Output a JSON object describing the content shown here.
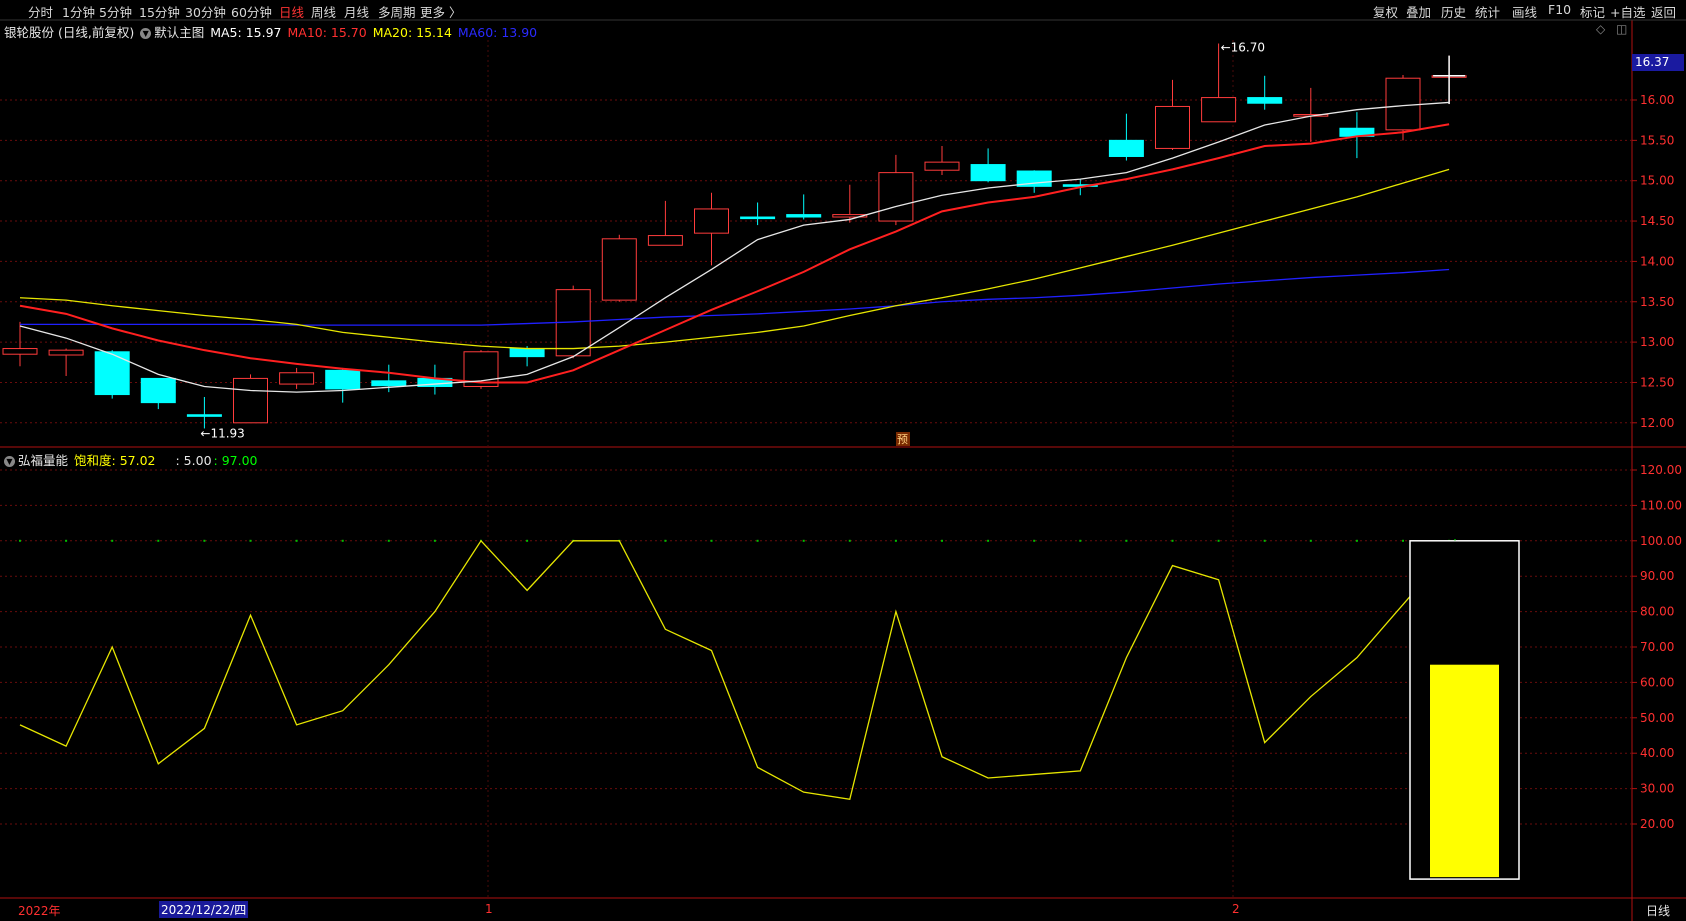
{
  "topbar": {
    "left_tabs": [
      "分时",
      "1分钟",
      "5分钟",
      "15分钟",
      "30分钟",
      "60分钟",
      "日线",
      "周线",
      "月线",
      "多周期",
      "更多 〉"
    ],
    "active": "日线",
    "right_tabs": [
      "复权",
      "叠加",
      "历史",
      "统计",
      "画线",
      "F10",
      "标记",
      "+自选",
      "返回"
    ]
  },
  "main_legend": {
    "stock": "银轮股份 (日线,前复权)",
    "chart_name": "默认主图",
    "ma5": "MA5: 15.97",
    "ma10": "MA10: 15.70",
    "ma20": "MA20: 15.14",
    "ma60": "MA60: 13.90"
  },
  "sub_legend": {
    "name": "弘福量能",
    "saturation": "饱和度: 57.02",
    "val1": ": 5.00",
    "val2": ": 97.00"
  },
  "annotations": {
    "high": "16.70",
    "low": "11.93",
    "pre_badge": "预"
  },
  "price_box": "16.37",
  "bottom": {
    "year": "2022年",
    "cursor_date": "2022/12/22/四",
    "month1": "1",
    "month2": "2",
    "period": "日线"
  },
  "chart_data": [
    {
      "type": "candlestick",
      "yticks": [
        "16.00",
        "15.50",
        "15.00",
        "14.50",
        "14.00",
        "13.50",
        "13.00",
        "12.50",
        "12.00"
      ],
      "ylim": [
        11.8,
        16.5
      ],
      "candles": [
        {
          "o": 12.85,
          "c": 12.92,
          "h": 13.25,
          "l": 12.7
        },
        {
          "o": 12.84,
          "c": 12.9,
          "h": 12.92,
          "l": 12.58
        },
        {
          "o": 12.88,
          "c": 12.35,
          "h": 12.9,
          "l": 12.3
        },
        {
          "o": 12.55,
          "c": 12.25,
          "h": 12.55,
          "l": 12.17
        },
        {
          "o": 12.1,
          "c": 12.08,
          "h": 12.32,
          "l": 11.93
        },
        {
          "o": 12.0,
          "c": 12.55,
          "h": 12.6,
          "l": 12.0
        },
        {
          "o": 12.48,
          "c": 12.62,
          "h": 12.68,
          "l": 12.42
        },
        {
          "o": 12.65,
          "c": 12.42,
          "h": 12.68,
          "l": 12.25
        },
        {
          "o": 12.52,
          "c": 12.46,
          "h": 12.72,
          "l": 12.38
        },
        {
          "o": 12.55,
          "c": 12.45,
          "h": 12.72,
          "l": 12.35
        },
        {
          "o": 12.45,
          "c": 12.88,
          "h": 12.9,
          "l": 12.42
        },
        {
          "o": 12.92,
          "c": 12.82,
          "h": 12.95,
          "l": 12.7
        },
        {
          "o": 12.83,
          "c": 13.65,
          "h": 13.7,
          "l": 12.8
        },
        {
          "o": 13.52,
          "c": 14.28,
          "h": 14.33,
          "l": 13.5
        },
        {
          "o": 14.2,
          "c": 14.32,
          "h": 14.75,
          "l": 14.2
        },
        {
          "o": 14.35,
          "c": 14.65,
          "h": 14.85,
          "l": 13.95
        },
        {
          "o": 14.55,
          "c": 14.53,
          "h": 14.73,
          "l": 14.45
        },
        {
          "o": 14.58,
          "c": 14.55,
          "h": 14.83,
          "l": 14.52
        },
        {
          "o": 14.55,
          "c": 14.58,
          "h": 14.95,
          "l": 14.48
        },
        {
          "o": 14.5,
          "c": 15.1,
          "h": 15.32,
          "l": 14.45
        },
        {
          "o": 15.13,
          "c": 15.23,
          "h": 15.43,
          "l": 15.07
        },
        {
          "o": 15.2,
          "c": 15.0,
          "h": 15.4,
          "l": 14.98
        },
        {
          "o": 15.12,
          "c": 14.93,
          "h": 15.13,
          "l": 14.85
        },
        {
          "o": 14.95,
          "c": 14.93,
          "h": 15.02,
          "l": 14.82
        },
        {
          "o": 15.5,
          "c": 15.3,
          "h": 15.83,
          "l": 15.25
        },
        {
          "o": 15.4,
          "c": 15.92,
          "h": 16.25,
          "l": 15.38
        },
        {
          "o": 15.73,
          "c": 16.03,
          "h": 16.7,
          "l": 15.73
        },
        {
          "o": 16.03,
          "c": 15.96,
          "h": 16.3,
          "l": 15.88
        },
        {
          "o": 15.8,
          "c": 15.82,
          "h": 16.15,
          "l": 15.48
        },
        {
          "o": 15.65,
          "c": 15.55,
          "h": 15.85,
          "l": 15.28
        },
        {
          "o": 15.63,
          "c": 16.27,
          "h": 16.31,
          "l": 15.5
        },
        {
          "o": 16.3,
          "c": 16.3,
          "h": 16.55,
          "l": 15.95
        }
      ],
      "ma5": [
        13.2,
        13.05,
        12.85,
        12.6,
        12.45,
        12.4,
        12.38,
        12.4,
        12.44,
        12.48,
        12.52,
        12.6,
        12.82,
        13.18,
        13.55,
        13.9,
        14.27,
        14.45,
        14.52,
        14.68,
        14.82,
        14.91,
        14.97,
        15.02,
        15.1,
        15.28,
        15.48,
        15.69,
        15.8,
        15.88,
        15.93,
        15.97
      ],
      "ma10": [
        13.45,
        13.35,
        13.17,
        13.02,
        12.9,
        12.8,
        12.73,
        12.67,
        12.62,
        12.55,
        12.5,
        12.5,
        12.65,
        12.9,
        13.15,
        13.4,
        13.63,
        13.87,
        14.15,
        14.37,
        14.62,
        14.73,
        14.8,
        14.92,
        15.02,
        15.14,
        15.28,
        15.43,
        15.46,
        15.55,
        15.6,
        15.7
      ],
      "ma20": [
        13.55,
        13.52,
        13.45,
        13.39,
        13.33,
        13.28,
        13.22,
        13.12,
        13.06,
        13.0,
        12.95,
        12.92,
        12.92,
        12.95,
        13.0,
        13.06,
        13.12,
        13.2,
        13.33,
        13.45,
        13.55,
        13.66,
        13.78,
        13.92,
        14.06,
        14.2,
        14.35,
        14.5,
        14.65,
        14.8,
        14.97,
        15.14
      ],
      "ma60": [
        13.22,
        13.22,
        13.22,
        13.22,
        13.22,
        13.22,
        13.21,
        13.21,
        13.21,
        13.21,
        13.21,
        13.23,
        13.25,
        13.28,
        13.31,
        13.33,
        13.35,
        13.38,
        13.41,
        13.45,
        13.5,
        13.53,
        13.55,
        13.58,
        13.62,
        13.67,
        13.72,
        13.76,
        13.8,
        13.83,
        13.86,
        13.9
      ]
    },
    {
      "type": "line",
      "yticks": [
        "120.00",
        "110.00",
        "100.00",
        "90.00",
        "80.00",
        "70.00",
        "60.00",
        "50.00",
        "40.00",
        "30.00",
        "20.00"
      ],
      "ylim": [
        5,
        125
      ],
      "values": [
        48,
        42,
        70,
        37,
        47,
        79,
        48,
        52,
        65,
        80,
        100,
        86,
        100,
        100,
        75,
        69,
        36,
        29,
        27,
        80,
        39,
        33,
        34,
        35,
        67,
        93,
        89,
        43,
        56,
        67,
        82,
        97
      ],
      "bar_value": 65
    }
  ]
}
